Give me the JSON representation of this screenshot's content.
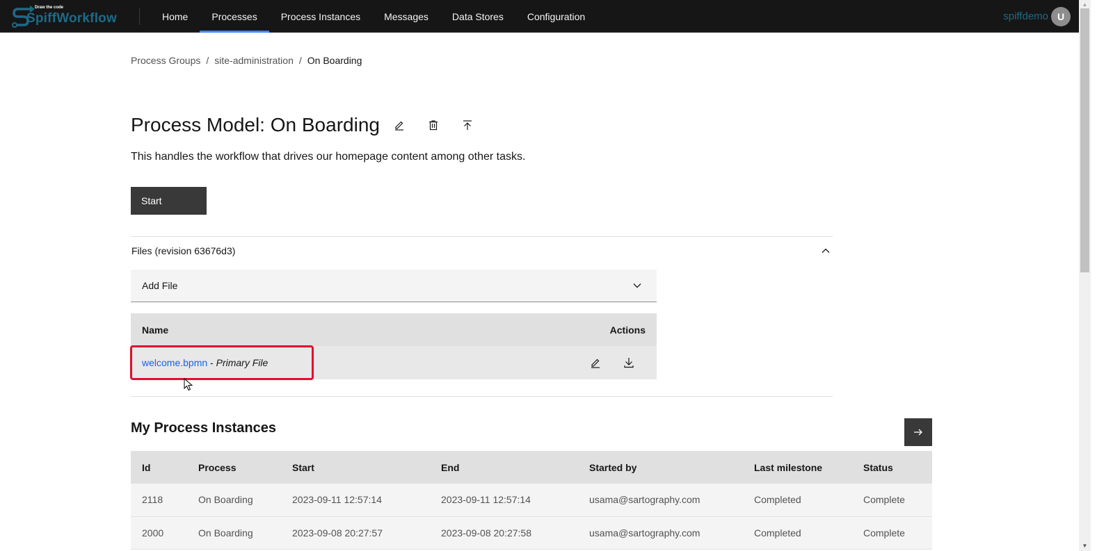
{
  "header": {
    "logo_tagline": "Draw the code",
    "logo_text": "SpiffWorkflow",
    "nav": [
      {
        "label": "Home",
        "active": false
      },
      {
        "label": "Processes",
        "active": true
      },
      {
        "label": "Process Instances",
        "active": false
      },
      {
        "label": "Messages",
        "active": false
      },
      {
        "label": "Data Stores",
        "active": false
      },
      {
        "label": "Configuration",
        "active": false
      }
    ],
    "username": "spiffdemo",
    "avatar_initial": "U"
  },
  "breadcrumb": {
    "items": [
      "Process Groups",
      "site-administration"
    ],
    "separator": "/",
    "current": "On Boarding"
  },
  "model": {
    "title": "Process Model: On Boarding",
    "description": "This handles the workflow that drives our homepage content among other tasks.",
    "title_icons": [
      "edit-icon",
      "delete-icon",
      "publish-icon"
    ],
    "start_label": "Start"
  },
  "files": {
    "section_title": "Files (revision 63676d3)",
    "add_file_label": "Add File",
    "columns": {
      "name": "Name",
      "actions": "Actions"
    },
    "rows": [
      {
        "file_name": "welcome.bpmn",
        "separator": " - ",
        "tag": "Primary File"
      }
    ]
  },
  "instances": {
    "title": "My Process Instances",
    "columns": [
      "Id",
      "Process",
      "Start",
      "End",
      "Started by",
      "Last milestone",
      "Status"
    ],
    "rows": [
      [
        "2118",
        "On Boarding",
        "2023-09-11 12:57:14",
        "2023-09-11 12:57:14",
        "usama@sartography.com",
        "Completed",
        "Complete"
      ],
      [
        "2000",
        "On Boarding",
        "2023-09-08 20:27:57",
        "2023-09-08 20:27:58",
        "usama@sartography.com",
        "Completed",
        "Complete"
      ]
    ]
  },
  "colors": {
    "header_bg": "#161616",
    "accent": "#4589ff",
    "brand": "#1d6a87",
    "link": "#0f62fe",
    "highlight": "#e0102f",
    "button_bg": "#393939"
  }
}
